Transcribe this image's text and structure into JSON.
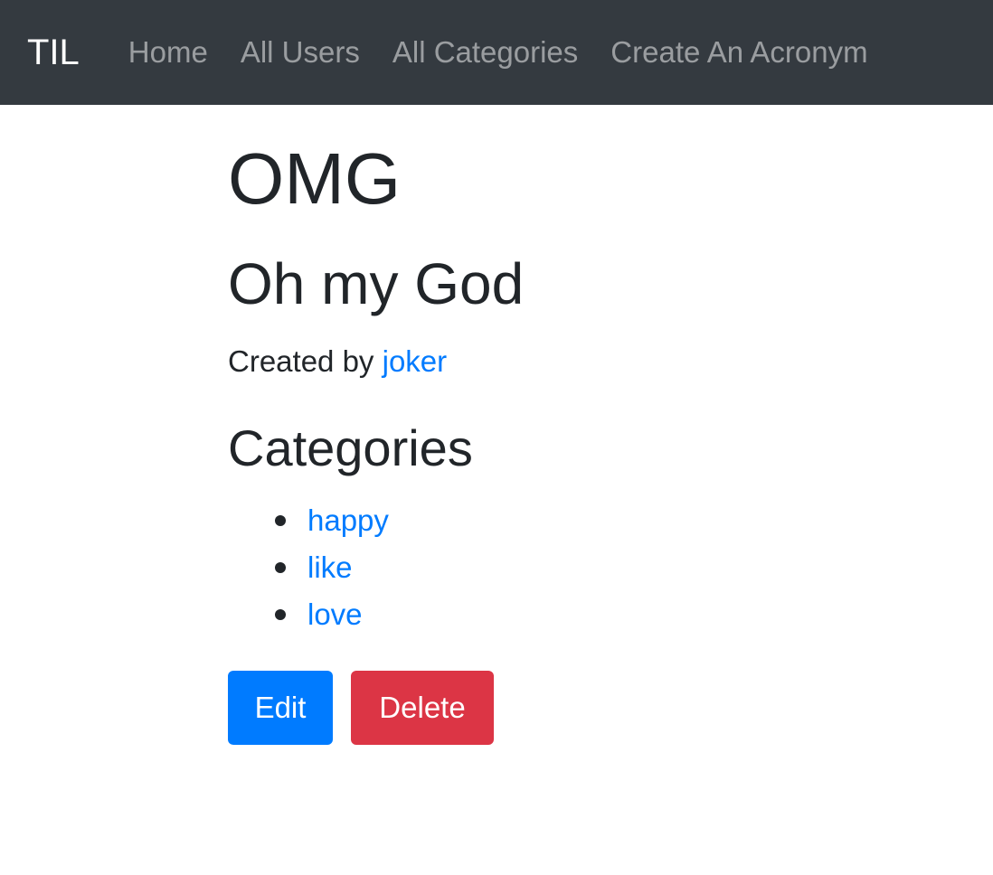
{
  "navbar": {
    "brand": "TIL",
    "links": [
      {
        "label": "Home"
      },
      {
        "label": "All Users"
      },
      {
        "label": "All Categories"
      },
      {
        "label": "Create An Acronym"
      }
    ]
  },
  "acronym": {
    "short": "OMG",
    "long": "Oh my God",
    "created_by_label": "Created by",
    "user": "joker"
  },
  "categories": {
    "heading": "Categories",
    "items": [
      {
        "name": "happy"
      },
      {
        "name": "like"
      },
      {
        "name": "love"
      }
    ]
  },
  "actions": {
    "edit_label": "Edit",
    "delete_label": "Delete"
  },
  "colors": {
    "navbar_bg": "#343a40",
    "link": "#007bff",
    "edit_button": "#007bff",
    "delete_button": "#dc3545"
  }
}
